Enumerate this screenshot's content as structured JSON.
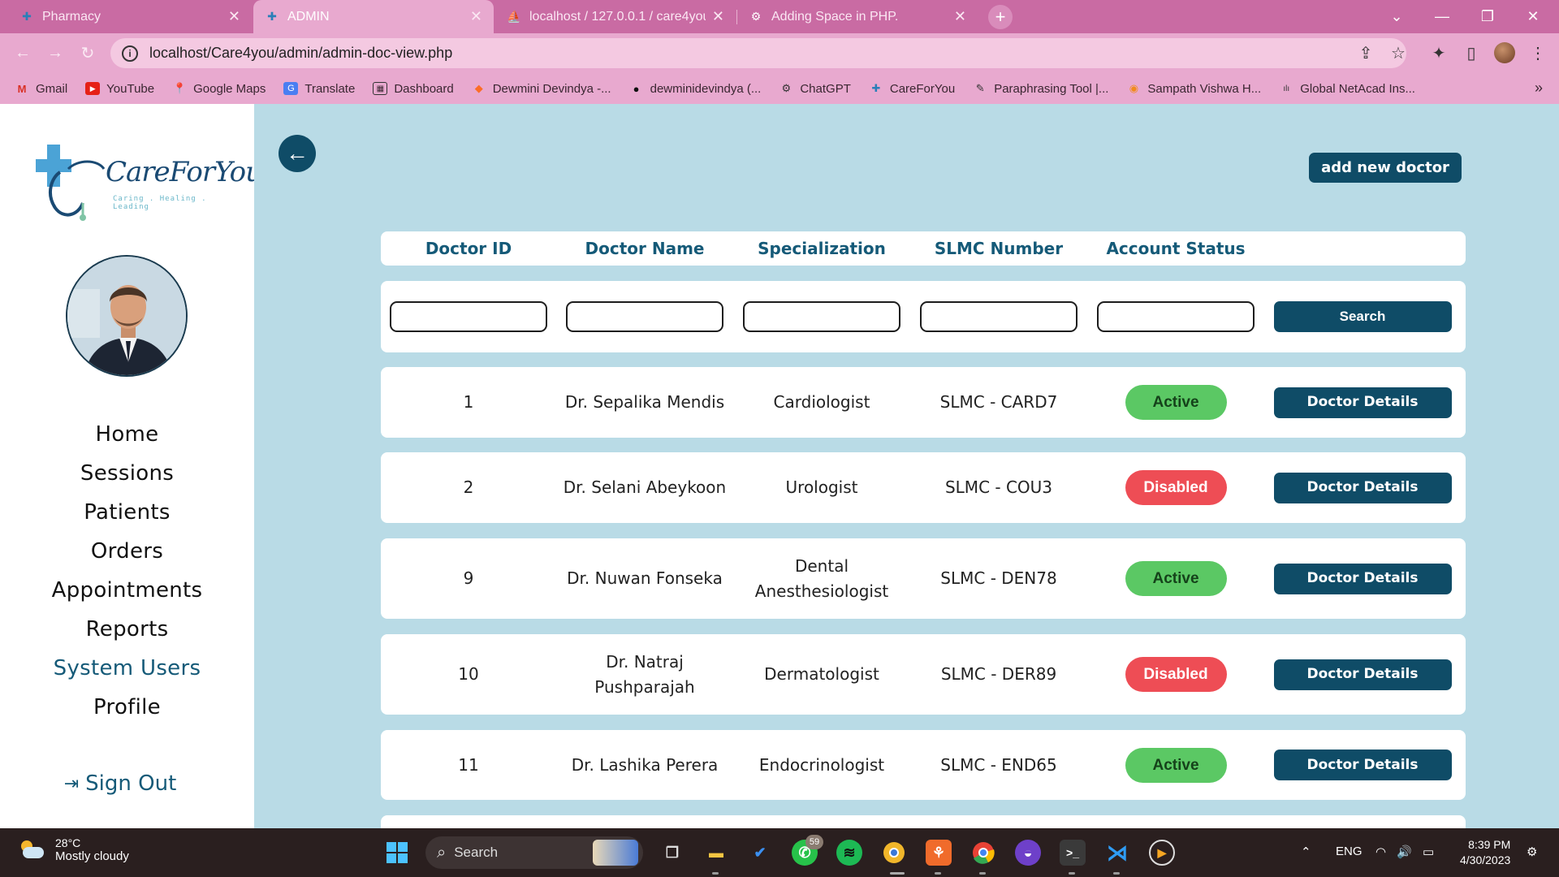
{
  "browser": {
    "tabs": [
      {
        "label": "Pharmacy",
        "active": false
      },
      {
        "label": "ADMIN",
        "active": true
      },
      {
        "label": "localhost / 127.0.0.1 / care4you /",
        "active": false
      },
      {
        "label": "Adding Space in PHP.",
        "active": false
      }
    ],
    "url": "localhost/Care4you/admin/admin-doc-view.php",
    "bookmarks": [
      "Gmail",
      "YouTube",
      "Google Maps",
      "Translate",
      "Dashboard",
      "Dewmini Devindya -...",
      "dewminidevindya (...",
      "ChatGPT",
      "CareForYou",
      "Paraphrasing Tool |...",
      "Sampath Vishwa H...",
      "Global NetAcad Ins..."
    ]
  },
  "sidebar": {
    "brand": "CareForYou",
    "tagline": "Caring . Healing . Leading",
    "nav": [
      {
        "label": "Home",
        "active": false
      },
      {
        "label": "Sessions",
        "active": false
      },
      {
        "label": "Patients",
        "active": false
      },
      {
        "label": "Orders",
        "active": false
      },
      {
        "label": "Appointments",
        "active": false
      },
      {
        "label": "Reports",
        "active": false
      },
      {
        "label": "System Users",
        "active": true
      },
      {
        "label": "Profile",
        "active": false
      }
    ],
    "signout": "Sign Out"
  },
  "main": {
    "add_button": "add new doctor",
    "columns": [
      "Doctor ID",
      "Doctor Name",
      "Specialization",
      "SLMC Number",
      "Account Status"
    ],
    "search_button": "Search",
    "details_button": "Doctor Details",
    "rows": [
      {
        "id": "1",
        "name": "Dr. Sepalika Mendis",
        "spec": "Cardiologist",
        "slmc": "SLMC - CARD7",
        "status": "Active"
      },
      {
        "id": "2",
        "name": "Dr. Selani Abeykoon",
        "spec": "Urologist",
        "slmc": "SLMC - COU3",
        "status": "Disabled"
      },
      {
        "id": "9",
        "name": "Dr. Nuwan Fonseka",
        "spec": "Dental Anesthesiologist",
        "slmc": "SLMC - DEN78",
        "status": "Active"
      },
      {
        "id": "10",
        "name": "Dr. Natraj Pushparajah",
        "spec": "Dermatologist",
        "slmc": "SLMC - DER89",
        "status": "Disabled"
      },
      {
        "id": "11",
        "name": "Dr. Lashika Perera",
        "spec": "Endocrinologist",
        "slmc": "SLMC - END65",
        "status": "Active"
      }
    ]
  },
  "taskbar": {
    "temp": "28°C",
    "weather": "Mostly cloudy",
    "search": "Search",
    "whatsapp_badge": "59",
    "lang": "ENG",
    "time": "8:39 PM",
    "date": "4/30/2023"
  },
  "colors": {
    "primary": "#0f4c67",
    "active_status": "#5bc864",
    "disabled_status": "#ee4d55",
    "main_bg": "#b9dbe6"
  }
}
